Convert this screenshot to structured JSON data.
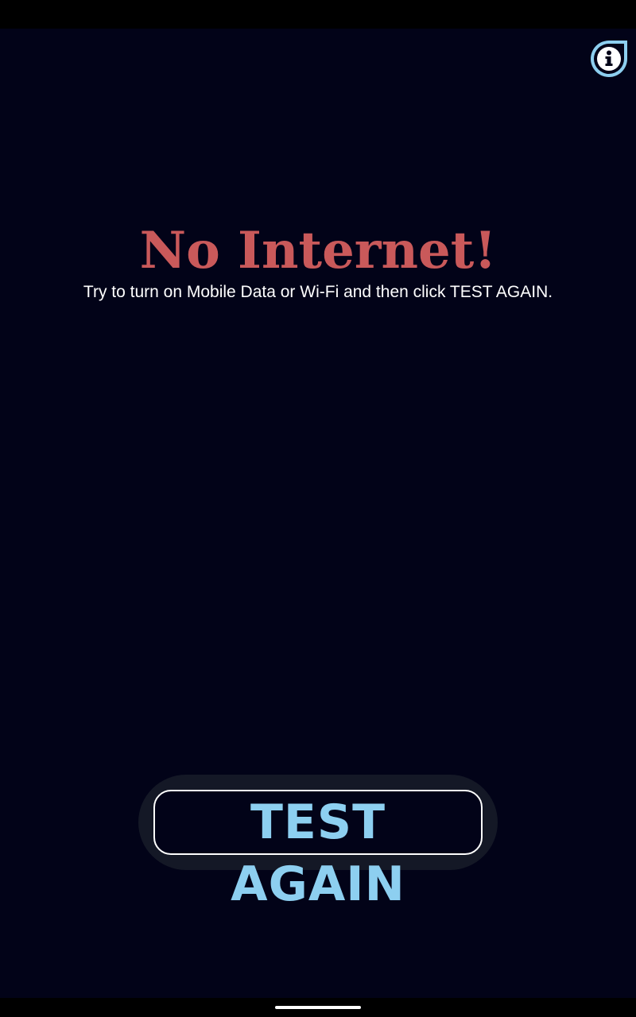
{
  "screen": {
    "title": "No Internet!",
    "message": "Try to turn on Mobile Data or Wi-Fi and then click TEST AGAIN.",
    "button_label": "TEST AGAIN"
  },
  "icons": {
    "info": "info-icon"
  },
  "colors": {
    "background": "#020318",
    "title": "#c9595a",
    "message": "#ffffff",
    "button_text": "#8dcff0",
    "button_border": "#ffffff",
    "info_icon_ring": "#8dcff0"
  }
}
